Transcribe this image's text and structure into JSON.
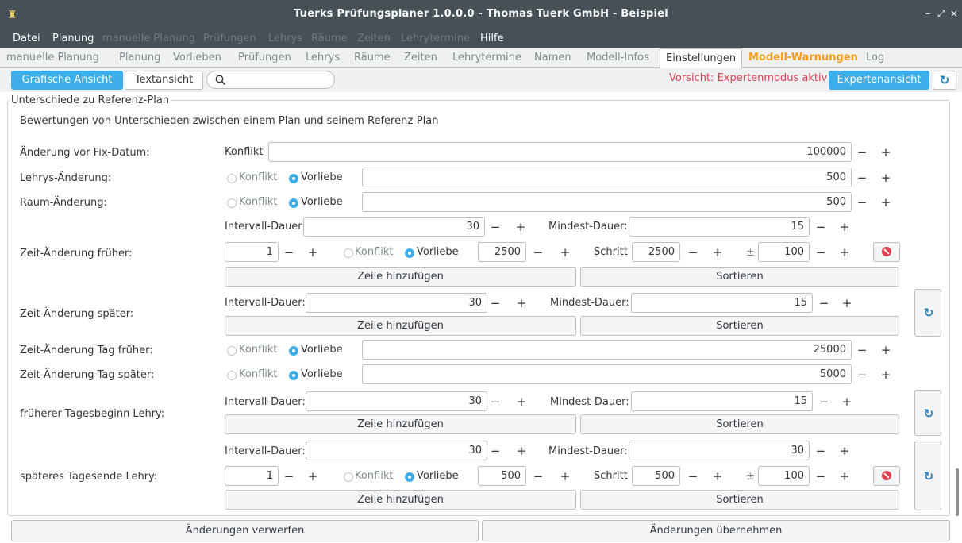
{
  "window": {
    "title": "Tuerks Prüfungsplaner 1.0.0.0 - Thomas Tuerk GmbH - Beispiel",
    "app_icon": "tower-icon",
    "controls": [
      "–",
      "⤢",
      "×"
    ]
  },
  "menu": [
    {
      "label": "Datei",
      "enabled": true
    },
    {
      "label": "Planung",
      "enabled": true
    },
    {
      "label": "manuelle Planung",
      "enabled": false
    },
    {
      "label": "Prüfungen",
      "enabled": false
    },
    {
      "label": "Lehrys",
      "enabled": false
    },
    {
      "label": "Räume",
      "enabled": false
    },
    {
      "label": "Zeiten",
      "enabled": false
    },
    {
      "label": "Lehrytermine",
      "enabled": false
    },
    {
      "label": "Hilfe",
      "enabled": true
    }
  ],
  "tabs": [
    {
      "label": "manuelle Planung"
    },
    {
      "label": "Planung"
    },
    {
      "label": "Vorlieben"
    },
    {
      "label": "Prüfungen"
    },
    {
      "label": "Lehrys"
    },
    {
      "label": "Räume"
    },
    {
      "label": "Zeiten"
    },
    {
      "label": "Lehrytermine"
    },
    {
      "label": "Namen"
    },
    {
      "label": "Modell-Infos"
    },
    {
      "label": "Einstellungen",
      "active": true
    },
    {
      "label": "Modell-Warnungen",
      "warning": true
    },
    {
      "label": "Log"
    }
  ],
  "toolbar": {
    "view_graphic": "Grafische Ansicht",
    "view_text": "Textansicht",
    "search_placeholder": "",
    "warning": "Vorsicht: Expertenmodus aktiv",
    "expert_view": "Expertenansicht"
  },
  "group": {
    "title": "Unterschiede zu Referenz-Plan",
    "description": "Bewertungen von Unterschieden zwischen einem Plan und seinem Referenz-Plan"
  },
  "labels": {
    "konflikt": "Konflikt",
    "vorliebe": "Vorliebe",
    "intervall": "Intervall-Dauer:",
    "mindest": "Mindest-Dauer:",
    "schritt": "Schritt",
    "plusminus": "±",
    "add_row": "Zeile hinzufügen",
    "sort": "Sortieren",
    "minus": "−",
    "plus": "+"
  },
  "rows": {
    "fix_datum": {
      "label": "Änderung vor Fix-Datum:",
      "value": "100000"
    },
    "lehrys": {
      "label": "Lehrys-Änderung:",
      "value": "500"
    },
    "raum": {
      "label": "Raum-Änderung:",
      "value": "500"
    },
    "zeit_frueher": {
      "label": "Zeit-Änderung früher:",
      "intervall": "30",
      "mindest": "15",
      "count": "1",
      "weight": "2500",
      "schritt": "2500",
      "pm": "100"
    },
    "zeit_spaeter": {
      "label": "Zeit-Änderung später:",
      "intervall": "30",
      "mindest": "15"
    },
    "tag_frueher": {
      "label": "Zeit-Änderung Tag früher:",
      "value": "25000"
    },
    "tag_spaeter": {
      "label": "Zeit-Änderung Tag später:",
      "value": "5000"
    },
    "tagesbeginn": {
      "label": "früherer Tagesbeginn Lehry:",
      "intervall": "30",
      "mindest": "15"
    },
    "tagesende": {
      "label": "späteres Tagesende Lehry:",
      "intervall": "30",
      "mindest": "30",
      "count": "1",
      "weight": "500",
      "schritt": "500",
      "pm": "100"
    }
  },
  "footer": {
    "discard": "Änderungen verwerfen",
    "apply": "Änderungen übernehmen"
  },
  "colors": {
    "titlebar": "#475057",
    "accent": "#3daee9",
    "warning_tab": "#f39c1f",
    "warning_text": "#da4453"
  }
}
